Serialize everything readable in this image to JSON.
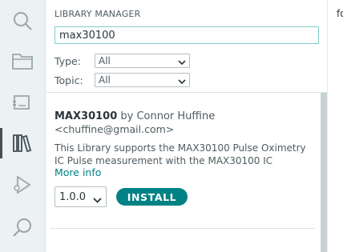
{
  "activity_bar": {
    "items": [
      {
        "icon": "search-icon"
      },
      {
        "icon": "folder-icon"
      },
      {
        "icon": "board-icon"
      },
      {
        "icon": "library-icon",
        "active": true
      },
      {
        "icon": "debug-icon"
      },
      {
        "icon": "search-icon"
      }
    ]
  },
  "panel": {
    "title": "LIBRARY MANAGER",
    "search": {
      "value": "max30100"
    },
    "filters": {
      "type_label": "Type:",
      "type_value": "All",
      "topic_label": "Topic:",
      "topic_value": "All"
    }
  },
  "library": {
    "name": "MAX30100",
    "by": "by Connor Huffine",
    "email": "<chuffine@gmail.com>",
    "description": "This Library supports the MAX30100 Pulse Oximetry IC Pulse measurement with the MAX30100 IC",
    "more_info": "More info",
    "version": "1.0.0",
    "install_label": "INSTALL"
  },
  "editor": {
    "visible_text": "fo"
  },
  "colors": {
    "accent": "#008184",
    "sidebar_bg": "#ecf1f1",
    "search_border": "#7fcbcd",
    "scrollbar": "#c9d2d2"
  }
}
